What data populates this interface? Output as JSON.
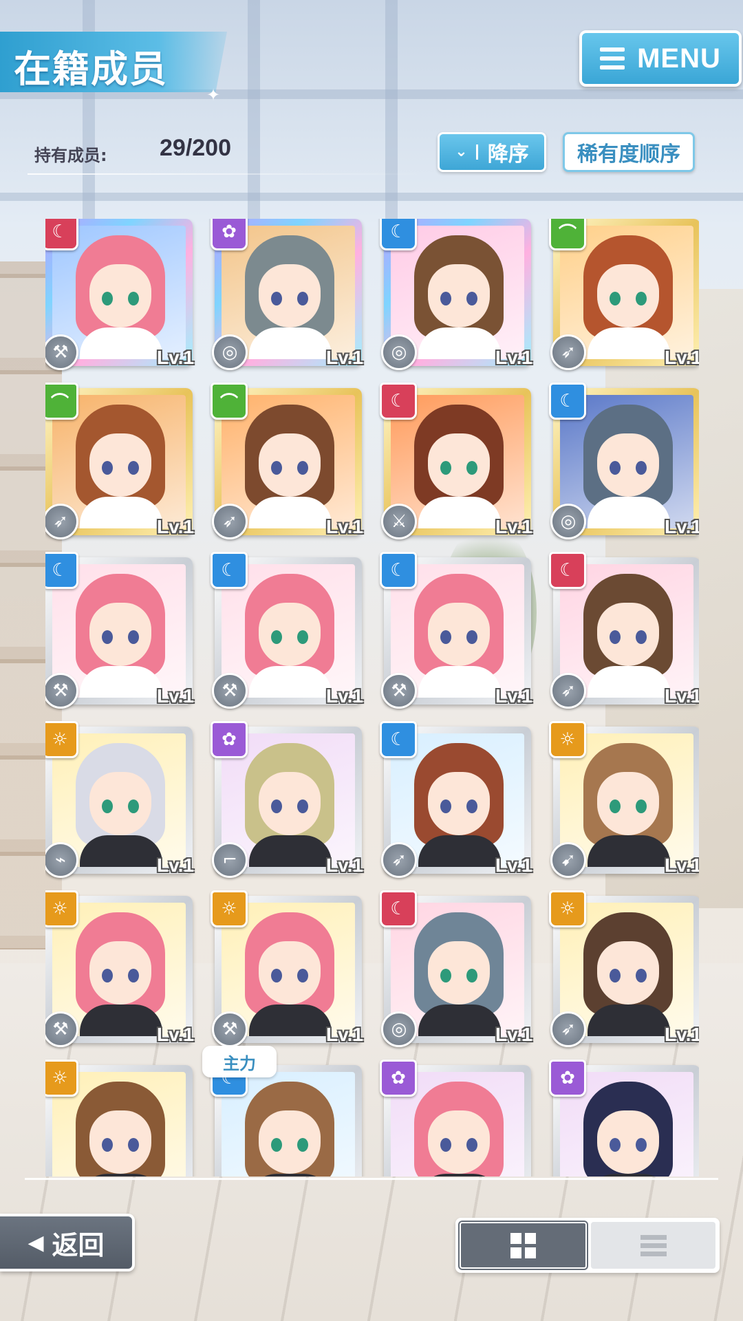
{
  "header": {
    "title": "在籍成员",
    "menu_label": "MENU",
    "owned_label": "持有成员:",
    "owned_count": "29/200"
  },
  "sort": {
    "order_label": "降序",
    "rarity_label": "稀有度顺序"
  },
  "colors": {
    "accent": "#3ea6d6",
    "attr_red": "#d8405a",
    "attr_purple": "#9a5ad6",
    "attr_blue": "#2f8fe0",
    "attr_green": "#4fb238",
    "attr_yellow": "#e69a1c"
  },
  "cards": [
    {
      "level": "Lv.1",
      "attribute": "moon-heart",
      "weapon": "hammer-icon",
      "frame": "rainbow"
    },
    {
      "level": "Lv.1",
      "attribute": "flower",
      "weapon": "shield-icon",
      "frame": "rainbow"
    },
    {
      "level": "Lv.1",
      "attribute": "crescent-clover",
      "weapon": "shield-icon",
      "frame": "rainbow"
    },
    {
      "level": "Lv.1",
      "attribute": "arc",
      "weapon": "spear-icon",
      "frame": "gold"
    },
    {
      "level": "Lv.1",
      "attribute": "arc",
      "weapon": "spear-icon",
      "frame": "gold"
    },
    {
      "level": "Lv.1",
      "attribute": "arc",
      "weapon": "spear-icon",
      "frame": "gold"
    },
    {
      "level": "Lv.1",
      "attribute": "moon-heart",
      "weapon": "axe-icon",
      "frame": "gold"
    },
    {
      "level": "Lv.1",
      "attribute": "crescent-clover",
      "weapon": "shield-icon",
      "frame": "gold"
    },
    {
      "level": "Lv.1",
      "attribute": "crescent-clover",
      "weapon": "hammer-icon",
      "frame": "silver"
    },
    {
      "level": "Lv.1",
      "attribute": "crescent-clover",
      "weapon": "hammer-icon",
      "frame": "silver"
    },
    {
      "level": "Lv.1",
      "attribute": "crescent-clover",
      "weapon": "hammer-icon",
      "frame": "silver"
    },
    {
      "level": "Lv.1",
      "attribute": "moon-heart",
      "weapon": "spear-icon",
      "frame": "silver"
    },
    {
      "level": "Lv.1",
      "attribute": "sun",
      "weapon": "rifle-icon",
      "frame": "silver"
    },
    {
      "level": "Lv.1",
      "attribute": "flower",
      "weapon": "gun-icon",
      "frame": "silver"
    },
    {
      "level": "Lv.1",
      "attribute": "crescent-clover",
      "weapon": "spear-icon",
      "frame": "silver"
    },
    {
      "level": "Lv.1",
      "attribute": "sun",
      "weapon": "lance-icon",
      "frame": "silver"
    },
    {
      "level": "Lv.1",
      "attribute": "sun",
      "weapon": "hammer-icon",
      "frame": "silver"
    },
    {
      "level": "Lv.1",
      "attribute": "sun",
      "weapon": "hammer-icon",
      "frame": "silver"
    },
    {
      "level": "Lv.1",
      "attribute": "moon-heart",
      "weapon": "shield-icon",
      "frame": "silver"
    },
    {
      "level": "Lv.1",
      "attribute": "sun",
      "weapon": "spear-icon",
      "frame": "silver"
    },
    {
      "level": "",
      "attribute": "sun",
      "weapon": "",
      "frame": "silver"
    },
    {
      "level": "",
      "attribute": "crescent-clover",
      "weapon": "",
      "frame": "silver"
    },
    {
      "level": "",
      "attribute": "flower",
      "weapon": "",
      "frame": "silver"
    },
    {
      "level": "",
      "attribute": "flower",
      "weapon": "",
      "frame": "silver"
    }
  ],
  "leader_tag": "主力",
  "footer": {
    "back_label": "返回",
    "view_grid": "grid-view-icon",
    "view_list": "list-view-icon"
  }
}
